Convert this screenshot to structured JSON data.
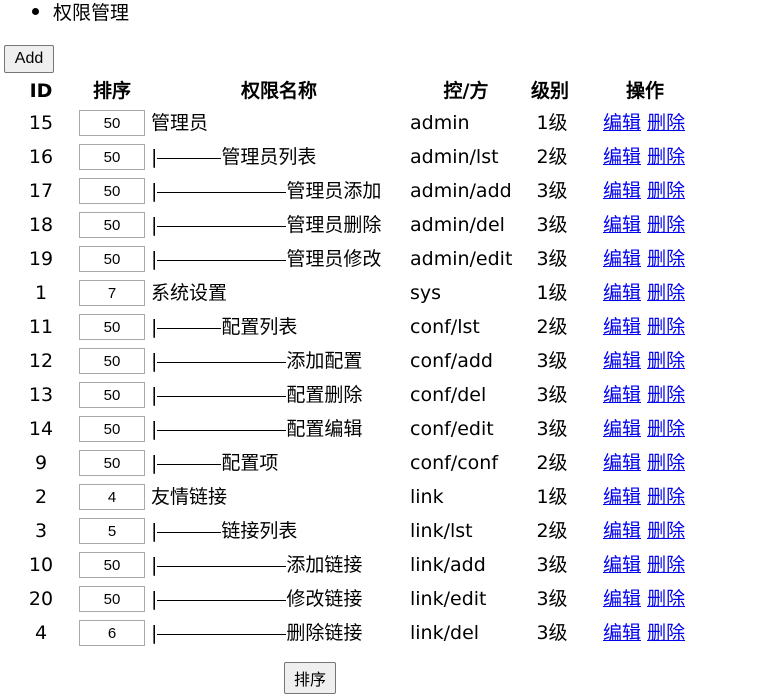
{
  "breadcrumb": {
    "label": "权限管理"
  },
  "add_button": "Add",
  "sort_button": "排序",
  "headers": {
    "id": "ID",
    "sort": "排序",
    "name": "权限名称",
    "ctrl": "控/方",
    "level": "级别",
    "ops": "操作"
  },
  "ops": {
    "edit": "编辑",
    "delete": "删除"
  },
  "rows": [
    {
      "id": "15",
      "sort": "50",
      "name": "管理员",
      "depth": 1,
      "ctrl": "admin",
      "level": "1级"
    },
    {
      "id": "16",
      "sort": "50",
      "name": "管理员列表",
      "depth": 2,
      "ctrl": "admin/lst",
      "level": "2级"
    },
    {
      "id": "17",
      "sort": "50",
      "name": "管理员添加",
      "depth": 3,
      "ctrl": "admin/add",
      "level": "3级"
    },
    {
      "id": "18",
      "sort": "50",
      "name": "管理员删除",
      "depth": 3,
      "ctrl": "admin/del",
      "level": "3级"
    },
    {
      "id": "19",
      "sort": "50",
      "name": "管理员修改",
      "depth": 3,
      "ctrl": "admin/edit",
      "level": "3级"
    },
    {
      "id": "1",
      "sort": "7",
      "name": "系统设置",
      "depth": 1,
      "ctrl": "sys",
      "level": "1级"
    },
    {
      "id": "11",
      "sort": "50",
      "name": "配置列表",
      "depth": 2,
      "ctrl": "conf/lst",
      "level": "2级"
    },
    {
      "id": "12",
      "sort": "50",
      "name": "添加配置",
      "depth": 3,
      "ctrl": "conf/add",
      "level": "3级"
    },
    {
      "id": "13",
      "sort": "50",
      "name": "配置删除",
      "depth": 3,
      "ctrl": "conf/del",
      "level": "3级"
    },
    {
      "id": "14",
      "sort": "50",
      "name": "配置编辑",
      "depth": 3,
      "ctrl": "conf/edit",
      "level": "3级"
    },
    {
      "id": "9",
      "sort": "50",
      "name": "配置项",
      "depth": 2,
      "ctrl": "conf/conf",
      "level": "2级"
    },
    {
      "id": "2",
      "sort": "4",
      "name": "友情链接",
      "depth": 1,
      "ctrl": "link",
      "level": "1级"
    },
    {
      "id": "3",
      "sort": "5",
      "name": "链接列表",
      "depth": 2,
      "ctrl": "link/lst",
      "level": "2级"
    },
    {
      "id": "10",
      "sort": "50",
      "name": "添加链接",
      "depth": 3,
      "ctrl": "link/add",
      "level": "3级"
    },
    {
      "id": "20",
      "sort": "50",
      "name": "修改链接",
      "depth": 3,
      "ctrl": "link/edit",
      "level": "3级"
    },
    {
      "id": "4",
      "sort": "6",
      "name": "删除链接",
      "depth": 3,
      "ctrl": "link/del",
      "level": "3级"
    }
  ]
}
